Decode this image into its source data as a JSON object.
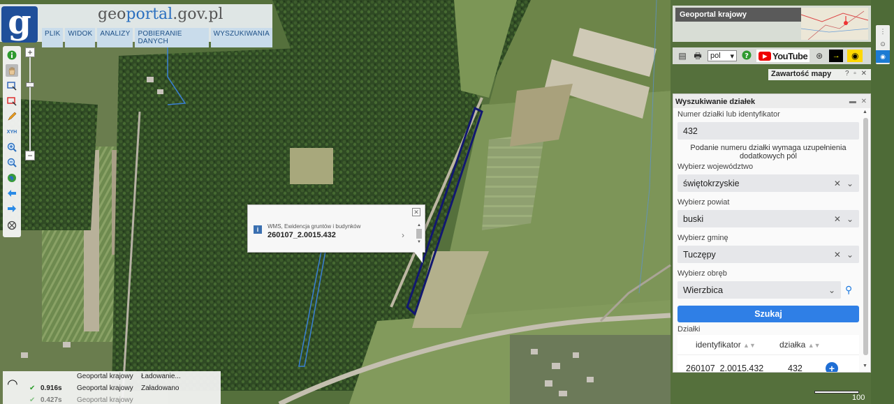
{
  "logo": {
    "letter": "g",
    "text_prefix": "geo",
    "text_main": "portal",
    "text_suffix": ".gov.pl"
  },
  "menu": [
    "PLIK",
    "WIDOK",
    "ANALIZY",
    "POBIERANIE DANYCH",
    "WYSZUKIWANIA"
  ],
  "geoportal_krajowy": {
    "title": "Geoportal krajowy"
  },
  "top_tools": {
    "language": "pol",
    "youtube_label": "YouTube"
  },
  "map_content": {
    "title": "Zawartość mapy"
  },
  "search_panel": {
    "title": "Wyszukiwanie działek",
    "number_label": "Numer działki lub identyfikator",
    "number_value": "432",
    "note": "Podanie numeru działki wymaga uzupełnienia dodatkowych pól",
    "voivodeship_label": "Wybierz województwo",
    "voivodeship_value": "świętokrzyskie",
    "county_label": "Wybierz powiat",
    "county_value": "buski",
    "commune_label": "Wybierz gminę",
    "commune_value": "Tuczępy",
    "precinct_label": "Wybierz obręb",
    "precinct_value": "Wierzbica",
    "search_button": "Szukaj",
    "results_label": "Działki",
    "results_columns": [
      "identyfikator",
      "działka"
    ],
    "results_rows": [
      {
        "id": "260107_2.0015.432",
        "parcel": "432"
      }
    ]
  },
  "popup": {
    "source": "WMS, Ewidencja gruntów i budynków",
    "identifier": "260107_2.0015.432"
  },
  "status": {
    "rows": [
      {
        "time": "",
        "source": "Geoportal krajowy",
        "state": "Ładowanie..."
      },
      {
        "time": "0.916s",
        "source": "Geoportal krajowy",
        "state": "Załadowano"
      },
      {
        "time": "0.427s",
        "source": "Geoportal krajowy",
        "state": ""
      }
    ]
  },
  "scale": {
    "label": "100"
  }
}
